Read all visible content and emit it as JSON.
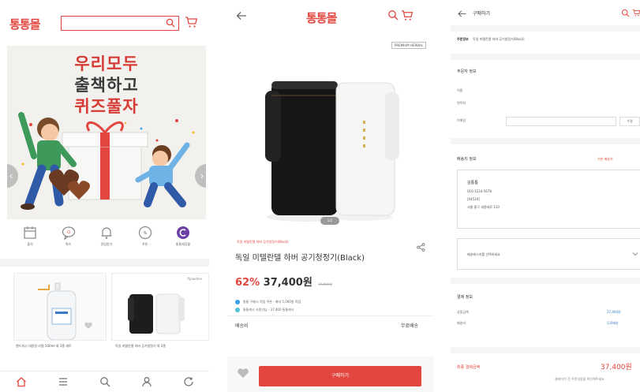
{
  "brand": {
    "name": "통통몰",
    "color": "#e2463f"
  },
  "home": {
    "search": {
      "value": "",
      "placeholder": ""
    },
    "banner": {
      "line1": "우리모두",
      "line2": "출책하고",
      "line3": "퀴즈풀자"
    },
    "quick_menu": [
      {
        "icon": "calendar-icon",
        "label": "출석"
      },
      {
        "icon": "gift-chat-icon",
        "label": "퀴즈"
      },
      {
        "icon": "bell-icon",
        "label": "알림받기"
      },
      {
        "icon": "coupon-icon",
        "label": "쿠폰"
      },
      {
        "icon": "partner-icon",
        "label": "통통제휴몰"
      }
    ],
    "products": [
      {
        "name": "핸드워시 대용량 리필 500ml 외 3종 세트"
      },
      {
        "name": "독일 미텔란델 하버 공기청정기 외 2종",
        "tag": "Ppaadine"
      }
    ],
    "bottom_nav": [
      {
        "icon": "home-icon"
      },
      {
        "icon": "menu-icon"
      },
      {
        "icon": "search-icon"
      },
      {
        "icon": "user-icon"
      },
      {
        "icon": "history-icon"
      }
    ]
  },
  "product": {
    "image_label": "PREMIUM HERBAL",
    "page_indicator": "1/2",
    "category": "독일 미텔란델 하버 공기청정기(Black)",
    "title": "독일 미텔란델 하버 공기청정기(Black)",
    "discount": "62%",
    "price": "37,400원",
    "original_price": "99,000원",
    "info": [
      {
        "text": "통통 구매시 적립 쿠폰 · 최대 5,000원 적립",
        "color": "#3aa0e8"
      },
      {
        "text": "통통캐시 사용가능 · 37,400 통통캐시",
        "color": "#4fc0d8"
      }
    ],
    "shipping_label": "배송비",
    "shipping_value": "무료배송",
    "buy_label": "구매하기"
  },
  "checkout": {
    "title": "구매하기",
    "order_info_label": "주문정보",
    "order_info_value": "독일 미텔란델 하버 공기청정기(Black)",
    "orderer_section": "주문자 정보",
    "orderer_rows": [
      "이름",
      "연락처",
      "이메일"
    ],
    "verify_button": "수정",
    "shipping_section": "배송지 정보",
    "shipping_link": "기본 배송지",
    "address": {
      "name": "김통통",
      "phone": "010-1234-5678",
      "zip": "[04524]",
      "street": "서울 중구 세종대로 110"
    },
    "delivery_request": "배송메시지를 선택하세요",
    "payment_section": "결제 정보",
    "payment_rows": [
      {
        "label": "상품금액",
        "value": "37,400원"
      },
      {
        "label": "배송비",
        "value": "무료배송"
      }
    ],
    "total_label": "최종 결제금액",
    "total_value": "37,400원",
    "total_note": "결제하기 전 주문내용을 확인해주세요"
  }
}
